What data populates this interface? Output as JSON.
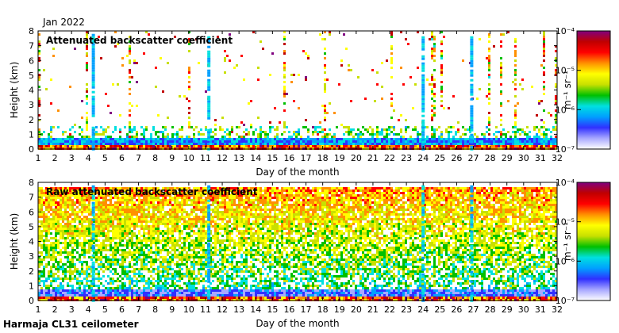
{
  "header": {
    "month_label": "Jan 2022"
  },
  "footer": {
    "instrument": "Harmaja CL31 ceilometer"
  },
  "colorbar": {
    "unit_label": "m⁻¹ sr⁻¹",
    "ticks": [
      "10⁻⁷",
      "10⁻⁶",
      "10⁻⁵",
      "10⁻⁴"
    ],
    "scale": "log",
    "range": [
      1e-07,
      0.0001
    ],
    "colors": [
      "#ffffff",
      "#a8a8ff",
      "#3030ff",
      "#00a0ff",
      "#00e0e0",
      "#00c000",
      "#c8e000",
      "#ffff00",
      "#ff9000",
      "#ff0000",
      "#c00000",
      "#800080"
    ]
  },
  "chart_data": [
    {
      "type": "heatmap",
      "title": "Attenuated backscatter coefficient",
      "xlabel": "Day of the month",
      "ylabel": "Height (km)",
      "xlim": [
        1,
        32
      ],
      "ylim": [
        0,
        8
      ],
      "x_ticks": [
        "1",
        "2",
        "3",
        "4",
        "5",
        "6",
        "7",
        "8",
        "9",
        "10",
        "11",
        "12",
        "13",
        "14",
        "15",
        "16",
        "17",
        "18",
        "19",
        "20",
        "21",
        "22",
        "23",
        "24",
        "25",
        "26",
        "27",
        "28",
        "29",
        "30",
        "31",
        "32"
      ],
      "y_ticks": [
        "0",
        "1",
        "2",
        "3",
        "4",
        "5",
        "6",
        "7",
        "8"
      ],
      "grid": false,
      "colorscale": "log",
      "value_range": [
        1e-07,
        0.0001
      ]
    },
    {
      "type": "heatmap",
      "title": "Raw attenuated backscatter coefficient",
      "xlabel": "Day of the month",
      "ylabel": "Height (km)",
      "xlim": [
        1,
        32
      ],
      "ylim": [
        0,
        8
      ],
      "x_ticks": [
        "1",
        "2",
        "3",
        "4",
        "5",
        "6",
        "7",
        "8",
        "9",
        "10",
        "11",
        "12",
        "13",
        "14",
        "15",
        "16",
        "17",
        "18",
        "19",
        "20",
        "21",
        "22",
        "23",
        "24",
        "25",
        "26",
        "27",
        "28",
        "29",
        "30",
        "31",
        "32"
      ],
      "y_ticks": [
        "0",
        "1",
        "2",
        "3",
        "4",
        "5",
        "6",
        "7",
        "8"
      ],
      "grid": false,
      "colorscale": "log",
      "value_range": [
        1e-07,
        0.0001
      ]
    }
  ]
}
